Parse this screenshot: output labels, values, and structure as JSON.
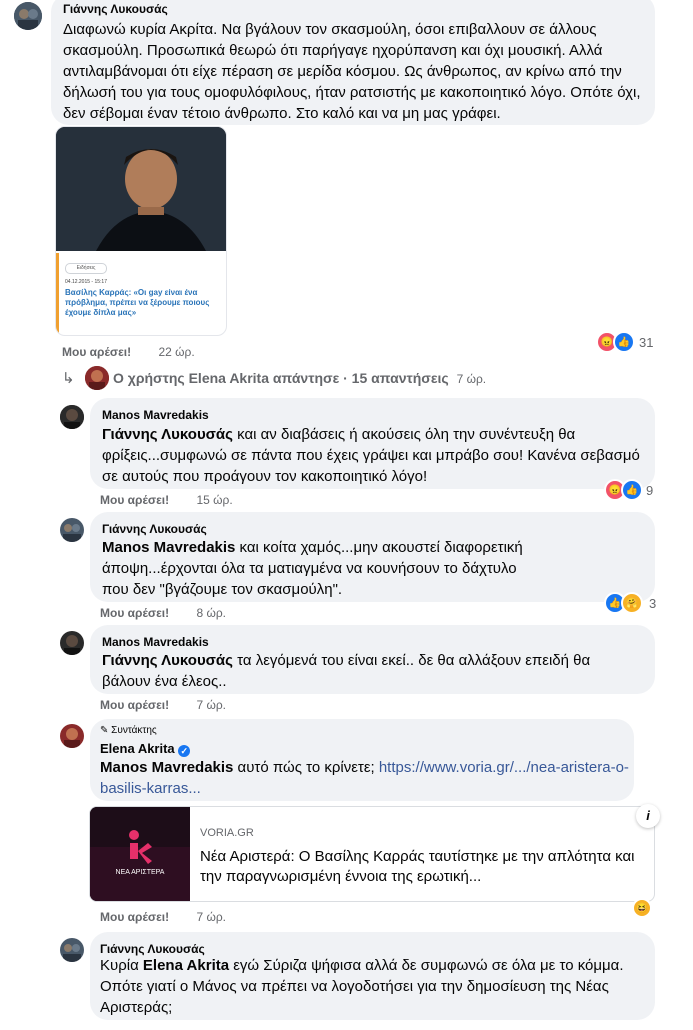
{
  "comments": [
    {
      "author": "Γιάννης Λυκουσάς",
      "text": "Διαφωνώ κυρία Ακρίτα. Να βγάλουν τον σκασμούλη, όσοι επιβαλλουν σε άλλους σκασμούλη. Προσωπικά θεωρώ ότι παρήγαγε ηχορύπανση και όχι μουσική. Αλλά αντιλαμβάνομαι ότι είχε πέραση σε μερίδα κόσμου. Ως άνθρωπος, αν κρίνω από την δήλωσή του για τους ομοφυλόφιλους, ήταν ρατσιστής με κακοποιητικό λόγο. Οπότε όχι, δεν σέβομαι έναν τέτοιο άνθρωπο. Στο καλό και να μη μας γράφει.",
      "like_label": "Μου αρέσει!",
      "time": "22 ώρ.",
      "reaction_count": "31",
      "attachment": {
        "tag": "Ειδήσεις",
        "date": "04.12.2015 - 15:17",
        "headline": "Βασίλης Καρράς: «Οι gay είναι ένα πρόβλημα, πρέπει να ξέρουμε ποιους έχουμε δίπλα μας»"
      }
    }
  ],
  "replies_summary": "Ο χρήστης Elena Akrita απάντησε · 15 απαντήσεις",
  "replies_summary_time": "7 ώρ.",
  "replies": [
    {
      "author": "Manos Mavredakis",
      "mention": "Γιάννης Λυκουσάς",
      "text": " και αν διαβάσεις ή ακούσεις όλη την συνέντευξη θα φρίξεις...συμφωνώ σε πάντα που έχεις γράψει και μπράβο σου! Κανένα σεβασμό σε αυτούς που προάγουν τον κακοποιητικό λόγο!",
      "like_label": "Μου αρέσει!",
      "time": "15 ώρ.",
      "reaction_count": "9"
    },
    {
      "author": "Γιάννης Λυκουσάς",
      "mention": "Manos Mavredakis",
      "text": " και κοίτα χαμός...μην ακουστεί διαφορετική άποψη...έρχονται όλα τα ματιαγμένα να κουνήσουν το δάχτυλο που δεν \"βγάζουμε τον σκασμούλη\".",
      "like_label": "Μου αρέσει!",
      "time": "8 ώρ.",
      "reaction_count": "3"
    },
    {
      "author": "Manos Mavredakis",
      "mention": "Γιάννης Λυκουσάς",
      "text": " τα λεγόμενά του είναι εκεί.. δε θα αλλάξουν επειδή θα βάλουν ένα έλεος..",
      "like_label": "Μου αρέσει!",
      "time": "7 ώρ."
    },
    {
      "badge": "Συντάκτης",
      "author": "Elena Akrita",
      "mention": "Manos Mavredakis",
      "text": " αυτό πώς το κρίνετε; ",
      "link": "https://www.voria.gr/.../nea-aristera-o-basilis-karras...",
      "preview_domain": "VORIA.GR",
      "preview_title": "Νέα Αριστερά: Ο Βασίλης Καρράς ταυτίστηκε με την απλότητα και την παραγνωρισμένη έννοια της ερωτική...",
      "preview_logo": "ΝΕΑ ΑΡΙΣΤΕΡΑ",
      "like_label": "Μου αρέσει!",
      "time": "7 ώρ."
    },
    {
      "author": "Γιάννης Λυκουσάς",
      "prefix": "Κυρία ",
      "mention": "Elena Akrita",
      "text": " εγώ Σύριζα ψήφισα αλλά δε συμφωνώ σε όλα με το κόμμα. Οπότε γιατί ο Μάνος να πρέπει να λογοδοτήσει για την δημοσίευση της Νέας Αριστεράς;"
    }
  ],
  "colors": {
    "bubble": "#f0f2f5",
    "link": "#385898",
    "muted": "#65676b",
    "like": "#1877f2"
  }
}
